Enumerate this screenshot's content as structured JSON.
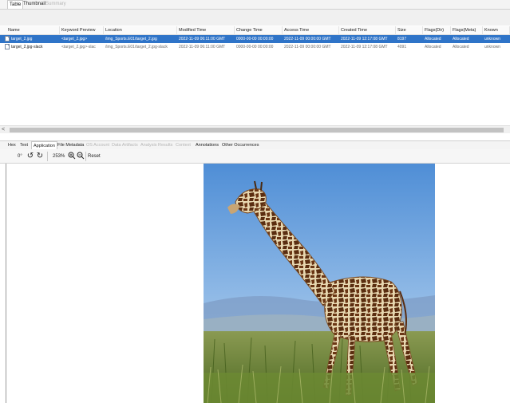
{
  "top_tabs": [
    {
      "label": "Table",
      "state": "active"
    },
    {
      "label": "Thumbnail",
      "state": "normal"
    },
    {
      "label": "Summary",
      "state": "disabled"
    }
  ],
  "table": {
    "columns": [
      "Name",
      "Keyword Preview",
      "Location",
      "Modified Time",
      "Change Time",
      "Access Time",
      "Created Time",
      "Size",
      "Flags(Dir)",
      "Flags(Meta)",
      "Known"
    ],
    "rows": [
      {
        "selected": true,
        "name": "target_2.jpg",
        "keyword_preview": "<target_2.jpg>",
        "location": "/img_Sports.E01/target_2.jpg",
        "modified": "2022-11-09 06:11:00 GMT",
        "change": "0000-00-00 00:00:00",
        "access": "2022-11-09 00:00:00 GMT",
        "created": "2022-11-09 12:17:08 GMT",
        "size": "8197",
        "flags_dir": "Allocated",
        "flags_meta": "Allocated",
        "known": "unknown"
      },
      {
        "selected": false,
        "name": "target_2.jpg-slack",
        "keyword_preview": "<target_2.jpg>-slac",
        "location": "/img_Sports.E01/target_2.jpg-slack",
        "modified": "2022-11-09 06:11:00 GMT",
        "change": "0000-00-00 00:00:00",
        "access": "2022-11-09 00:00:00 GMT",
        "created": "2022-11-09 12:17:08 GMT",
        "size": "4091",
        "flags_dir": "Allocated",
        "flags_meta": "Allocated",
        "known": "unknown"
      }
    ]
  },
  "scrollbar": {
    "left_arrow": "<"
  },
  "content_tabs": [
    {
      "label": "Hex",
      "state": "normal"
    },
    {
      "label": "Text",
      "state": "normal"
    },
    {
      "label": "Application",
      "state": "active"
    },
    {
      "label": "File Metadata",
      "state": "normal"
    },
    {
      "label": "OS Account",
      "state": "disabled"
    },
    {
      "label": "Data Artifacts",
      "state": "disabled"
    },
    {
      "label": "Analysis Results",
      "state": "disabled"
    },
    {
      "label": "Context",
      "state": "disabled"
    },
    {
      "label": "Annotations",
      "state": "normal"
    },
    {
      "label": "Other Occurrences",
      "state": "normal"
    }
  ],
  "image_toolbar": {
    "rotation": "0°",
    "zoom": "253%",
    "reset_label": "Reset"
  },
  "colors": {
    "selection": "#2f74c8",
    "sky": "#5f9ad6",
    "grass": "#6f8c3a"
  }
}
